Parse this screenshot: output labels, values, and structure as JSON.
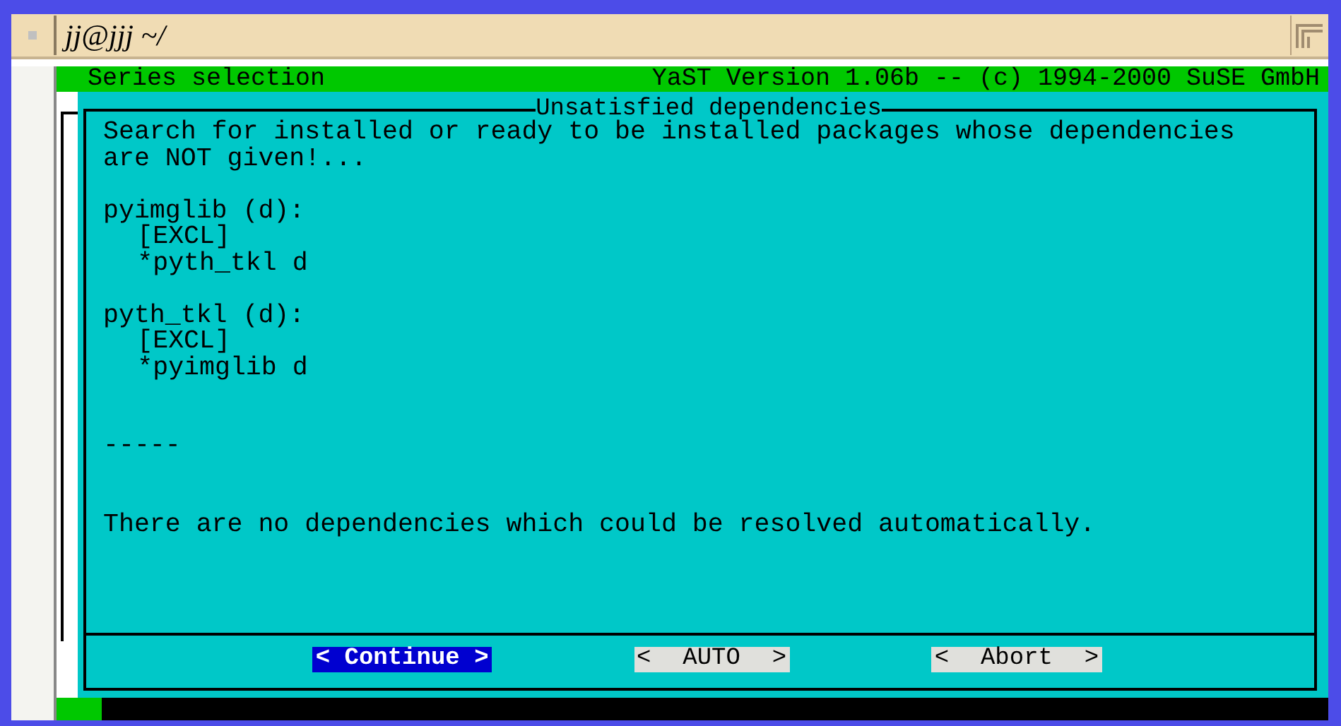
{
  "window": {
    "title": "jj@jjj ~/"
  },
  "header": {
    "left": "Series selection",
    "right": "YaST Version 1.06b -- (c) 1994-2000 SuSE GmbH"
  },
  "dialog": {
    "title": "Unsatisfied dependencies",
    "intro": "Search for installed or ready to be installed packages whose dependencies are NOT given!...",
    "packages": [
      {
        "name": "pyimglib (d):",
        "entries": [
          "[EXCL]",
          "*pyth_tkl d"
        ]
      },
      {
        "name": "pyth_tkl (d):",
        "entries": [
          "[EXCL]",
          "*pyimglib d"
        ]
      }
    ],
    "separator": "-----",
    "message": "There are no dependencies which could be resolved automatically.",
    "buttons": [
      {
        "left": "<",
        "label": "Continue",
        "right": ">",
        "selected": true
      },
      {
        "left": "<",
        "label": "AUTO",
        "right": ">",
        "selected": false
      },
      {
        "left": "<",
        "label": "Abort",
        "right": ">",
        "selected": false
      }
    ]
  }
}
